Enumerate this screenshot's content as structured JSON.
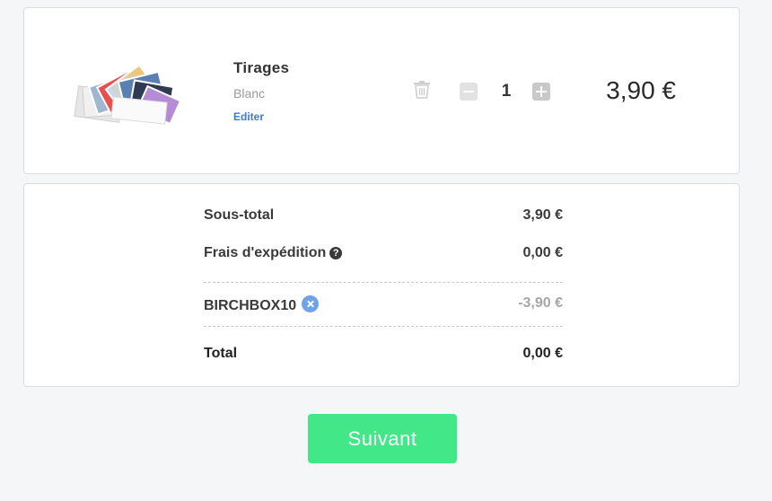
{
  "cart_item": {
    "title": "Tirages",
    "variant": "Blanc",
    "edit_label": "Editer",
    "quantity": "1",
    "price": "3,90 €",
    "thumbnail_icon": "photo-prints-stack-icon",
    "delete_icon": "trash-icon"
  },
  "summary": {
    "subtotal_label": "Sous-total",
    "subtotal_value": "3,90 €",
    "shipping_label": "Frais d'expédition",
    "shipping_help_icon": "question-circle-icon",
    "shipping_value": "0,00 €",
    "promo_code": "BIRCHBOX10",
    "promo_remove_icon": "remove-circle-icon",
    "promo_value": "-3,90 €",
    "total_label": "Total",
    "total_value": "0,00 €"
  },
  "actions": {
    "next_label": "Suivant"
  },
  "colors": {
    "accent_green": "#42e887",
    "link_blue": "#3a7bd5",
    "remove_blue": "#6fa3e8"
  }
}
